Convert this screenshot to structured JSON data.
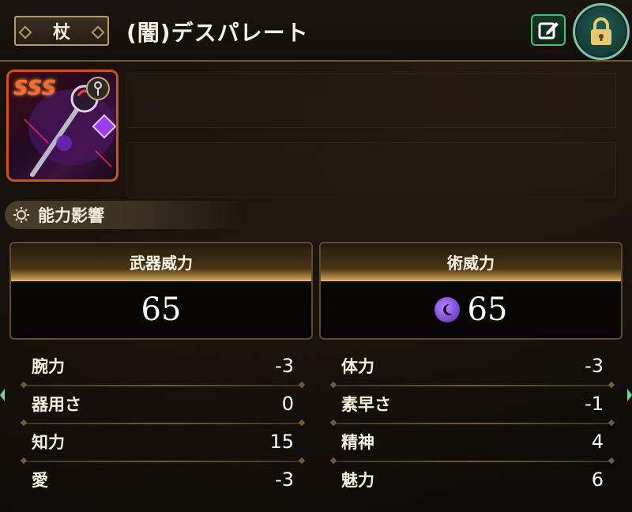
{
  "header": {
    "category": "杖",
    "weapon_name": "(闇)デスパレート"
  },
  "icons": {
    "edit": "edit-icon",
    "lock": "lock-icon",
    "element": "dark-moon-icon",
    "weapon_type": "staff-type-icon"
  },
  "weapon": {
    "rarity": "SSS",
    "element_color": "#9b3df0"
  },
  "section": {
    "title": "能力影響"
  },
  "power": {
    "weapon_label": "武器威力",
    "weapon_value": "65",
    "art_label": "術威力",
    "art_value": "65"
  },
  "stats": {
    "left": [
      {
        "label": "腕力",
        "value": "-3"
      },
      {
        "label": "器用さ",
        "value": "0"
      },
      {
        "label": "知力",
        "value": "15"
      },
      {
        "label": "愛",
        "value": "-3"
      }
    ],
    "right": [
      {
        "label": "体力",
        "value": "-3"
      },
      {
        "label": "素早さ",
        "value": "-1"
      },
      {
        "label": "精神",
        "value": "4"
      },
      {
        "label": "魅力",
        "value": "6"
      }
    ]
  },
  "colors": {
    "accent_gold": "#d8b56b",
    "edit_green": "#3cc27a",
    "lock_teal": "#1f5d52"
  }
}
